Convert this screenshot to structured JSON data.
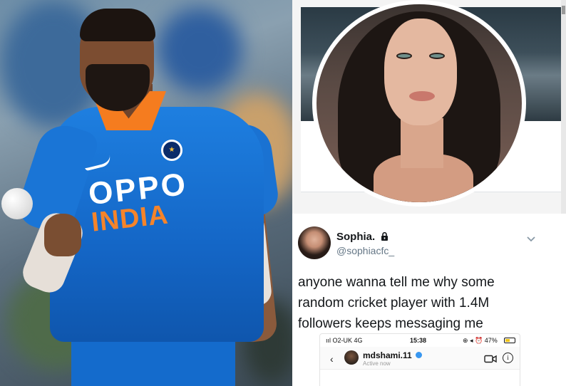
{
  "left_photo": {
    "sponsor_text": "OPPO",
    "team_text": "INDIA",
    "emblem_glyph": "★",
    "colors": {
      "jersey": "#1a75d6",
      "accent_orange": "#f57c1f",
      "sponsor": "#ffffff"
    }
  },
  "tweet": {
    "display_name": "Sophia.",
    "handle": "@sophiacfc_",
    "body": "anyone wanna tell me why some random cricket player with 1.4M followers keeps messaging me",
    "icons": {
      "lock": "lock-icon",
      "menu": "chevron-down-icon"
    }
  },
  "phone_screenshot": {
    "carrier": "ııl O2-UK  4G",
    "time": "15:38",
    "status_icons": "⊕ ◂ ⏰ 47%",
    "battery_level": 0.47,
    "back_glyph": "‹",
    "dm_username": "mdshami.11",
    "dm_status": "Active now",
    "info_glyph": "i"
  }
}
